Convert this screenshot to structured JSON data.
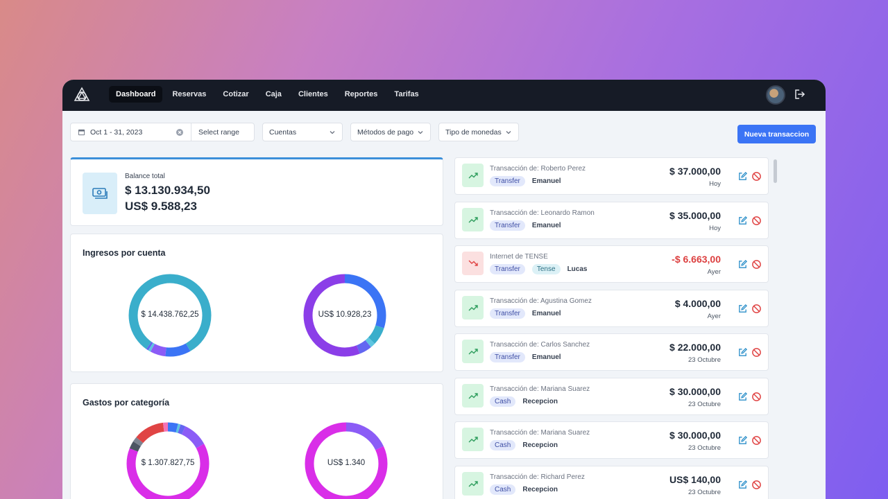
{
  "nav": {
    "items": [
      {
        "label": "Dashboard",
        "active": true
      },
      {
        "label": "Reservas"
      },
      {
        "label": "Cotizar"
      },
      {
        "label": "Caja"
      },
      {
        "label": "Clientes"
      },
      {
        "label": "Reportes"
      },
      {
        "label": "Tarifas"
      }
    ]
  },
  "filters": {
    "date_range": "Oct 1 - 31, 2023",
    "select_range": "Select range",
    "cuentas": "Cuentas",
    "metodos": "Métodos de pago",
    "monedas": "Tipo de monedas"
  },
  "actions": {
    "new_transaction": "Nueva transaccion"
  },
  "balance": {
    "label": "Balance total",
    "ars": "$ 13.130.934,50",
    "usd": "US$ 9.588,23"
  },
  "ingresos": {
    "title": "Ingresos por cuenta",
    "left_total": "$ 14.438.762,25",
    "right_total": "US$ 10.928,23",
    "left_segments": [
      {
        "color": "#3aaecb",
        "fraction": 0.82
      },
      {
        "color": "#3b74f5",
        "fraction": 0.1
      },
      {
        "color": "#8b5cf6",
        "fraction": 0.06
      },
      {
        "color": "#5ec5e0",
        "fraction": 0.01
      },
      {
        "color": "#6366f1",
        "fraction": 0.01
      }
    ],
    "right_segments": [
      {
        "color": "#3b74f5",
        "fraction": 0.3
      },
      {
        "color": "#3aaecb",
        "fraction": 0.07
      },
      {
        "color": "#5ec5e0",
        "fraction": 0.02
      },
      {
        "color": "#6366f1",
        "fraction": 0.05
      },
      {
        "color": "#8b3ee8",
        "fraction": 0.56
      }
    ]
  },
  "gastos": {
    "title": "Gastos por categoría",
    "left_total": "$ 1.307.827,75",
    "right_total": "US$ 1.340",
    "left_segments": [
      {
        "color": "#3b74f5",
        "fraction": 0.04
      },
      {
        "color": "#5ec5e0",
        "fraction": 0.01
      },
      {
        "color": "#6366f1",
        "fraction": 0.02
      },
      {
        "color": "#8b5cf6",
        "fraction": 0.1
      },
      {
        "color": "#d92ee8",
        "fraction": 0.64
      },
      {
        "color": "#4b5563",
        "fraction": 0.03
      },
      {
        "color": "#7b8391",
        "fraction": 0.02
      },
      {
        "color": "#e04444",
        "fraction": 0.12
      },
      {
        "color": "#f472b6",
        "fraction": 0.02
      }
    ],
    "right_segments": [
      {
        "color": "#8b5cf6",
        "fraction": 0.18
      },
      {
        "color": "#d92ee8",
        "fraction": 0.82
      }
    ]
  },
  "transactions": [
    {
      "title": "Transacción de: Roberto Perez",
      "tags": [
        "Transfer"
      ],
      "user": "Emanuel",
      "amount": "$ 37.000,00",
      "date": "Hoy",
      "direction": "up"
    },
    {
      "title": "Transacción de: Leonardo Ramon",
      "tags": [
        "Transfer"
      ],
      "user": "Emanuel",
      "amount": "$ 35.000,00",
      "date": "Hoy",
      "direction": "up"
    },
    {
      "title": "Internet de TENSE",
      "tags": [
        "Transfer",
        "Tense"
      ],
      "user": "Lucas",
      "amount": "-$ 6.663,00",
      "date": "Ayer",
      "direction": "down"
    },
    {
      "title": "Transacción de: Agustina Gomez",
      "tags": [
        "Transfer"
      ],
      "user": "Emanuel",
      "amount": "$ 4.000,00",
      "date": "Ayer",
      "direction": "up"
    },
    {
      "title": "Transacción de: Carlos Sanchez",
      "tags": [
        "Transfer"
      ],
      "user": "Emanuel",
      "amount": "$ 22.000,00",
      "date": "23 Octubre",
      "direction": "up"
    },
    {
      "title": "Transacción de: Mariana Suarez",
      "tags": [
        "Cash"
      ],
      "user": "Recepcion",
      "amount": "$ 30.000,00",
      "date": "23 Octubre",
      "direction": "up"
    },
    {
      "title": "Transacción de: Mariana Suarez",
      "tags": [
        "Cash"
      ],
      "user": "Recepcion",
      "amount": "$ 30.000,00",
      "date": "23 Octubre",
      "direction": "up"
    },
    {
      "title": "Transacción de: Richard Perez",
      "tags": [
        "Cash"
      ],
      "user": "Recepcion",
      "amount": "US$ 140,00",
      "date": "23 Octubre",
      "direction": "up"
    }
  ],
  "icons": {
    "logo": "triangle-knot-logo",
    "logout": "logout-icon",
    "calendar": "calendar-icon",
    "clear": "clear-icon",
    "chevron": "chevron-down-icon",
    "balance": "money-icon",
    "trend_up": "trend-up-icon",
    "trend_down": "trend-down-icon",
    "edit": "edit-icon",
    "delete": "block-icon"
  }
}
